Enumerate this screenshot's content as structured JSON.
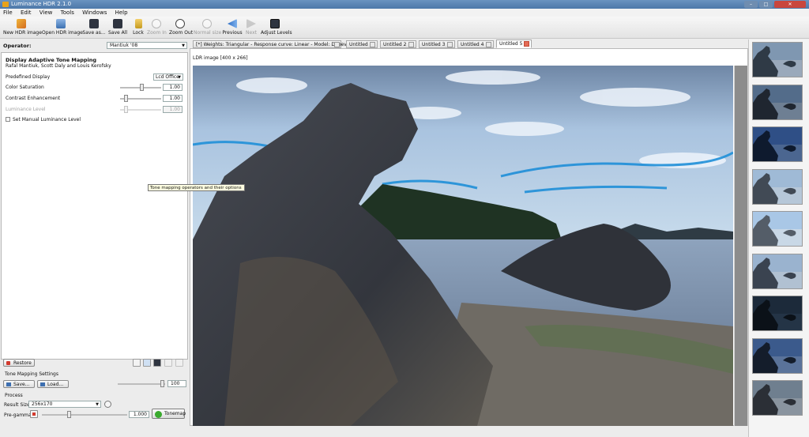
{
  "window": {
    "title": "Luminance HDR 2.1.0"
  },
  "menu": [
    "File",
    "Edit",
    "View",
    "Tools",
    "Windows",
    "Help"
  ],
  "toolbar": {
    "new_hdr": "New HDR image",
    "open_hdr": "Open HDR image",
    "save_as": "Save as...",
    "save_all": "Save All",
    "lock": "Lock",
    "zoom_in": "Zoom In",
    "zoom_out": "Zoom Out",
    "normal_size": "Normal size",
    "previous": "Previous",
    "next": "Next",
    "adjust_levels": "Adjust Levels"
  },
  "operator": {
    "label": "Operator:",
    "value": "Mantiuk '08"
  },
  "settings": {
    "title": "Display Adaptive Tone Mapping",
    "authors": "Rafal Mantiuk, Scott Daly and Louis Kerofsky",
    "predefined_display": {
      "label": "Predefined Display",
      "value": "Lcd Office"
    },
    "color_saturation": {
      "label": "Color Saturation",
      "value": "1.00",
      "slider": 0.55
    },
    "contrast_enhancement": {
      "label": "Contrast Enhancement",
      "value": "1.00",
      "slider": 0.1
    },
    "luminance_level": {
      "label": "Luminance Level",
      "value": "1.00",
      "slider": 0.1
    },
    "manual_luminance": "Set Manual Luminance Level"
  },
  "restore": "Restore",
  "tone_mapping_settings": "Tone Mapping Settings",
  "save_btn": "Save...",
  "load_btn": "Load...",
  "load_value": "100",
  "process_label": "Process",
  "result_size": {
    "label": "Result Size:",
    "value": "256x170"
  },
  "pregamma": {
    "label": "Pre-gamma:",
    "value": "1.000"
  },
  "tonemap_btn": "Tonemap",
  "tooltip": "Tone mapping operators and their options",
  "tabs": [
    "[*] Weights: Triangular - Response curve: Linear - Model: Debevec",
    "Untitled",
    "Untitled 2",
    "Untitled 3",
    "Untitled 4",
    "Untitled 5"
  ],
  "image_label": "LDR image [400 x 266]",
  "colors": {
    "accent": "#4d78a9",
    "close": "#c9463d",
    "tonemap": "#3aaa2e"
  },
  "preview_count": 9
}
